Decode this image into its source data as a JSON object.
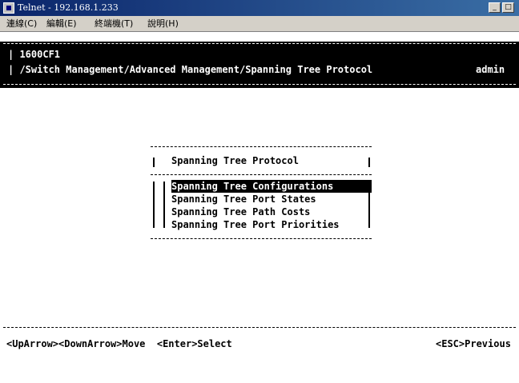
{
  "window": {
    "title": "Telnet - 192.168.1.233",
    "minimize_glyph": "_",
    "maximize_glyph": "□"
  },
  "menubar": {
    "items": [
      {
        "label": "連線(C)"
      },
      {
        "label": "編輯(E)"
      },
      {
        "label": "終端機(T)"
      },
      {
        "label": "說明(H)"
      }
    ]
  },
  "terminal": {
    "device_name": "1600CF1",
    "path": "/Switch Management/Advanced Management/Spanning Tree Protocol",
    "user": "admin",
    "menu": {
      "title": "Spanning Tree Protocol",
      "options": [
        {
          "label": "Spanning Tree Configurations",
          "selected": true
        },
        {
          "label": "Spanning Tree Port States",
          "selected": false
        },
        {
          "label": "Spanning Tree Path Costs",
          "selected": false
        },
        {
          "label": "Spanning Tree Port Priorities",
          "selected": false
        }
      ]
    },
    "footer": {
      "navigation_hint": "<UpArrow><DownArrow>Move  <Enter>Select",
      "escape_hint": "<ESC>Previous"
    }
  },
  "colors": {
    "title_bar": "#0a246a",
    "terminal_bg": "#ffffff",
    "header_bg": "#000000",
    "highlight": "#000000"
  }
}
